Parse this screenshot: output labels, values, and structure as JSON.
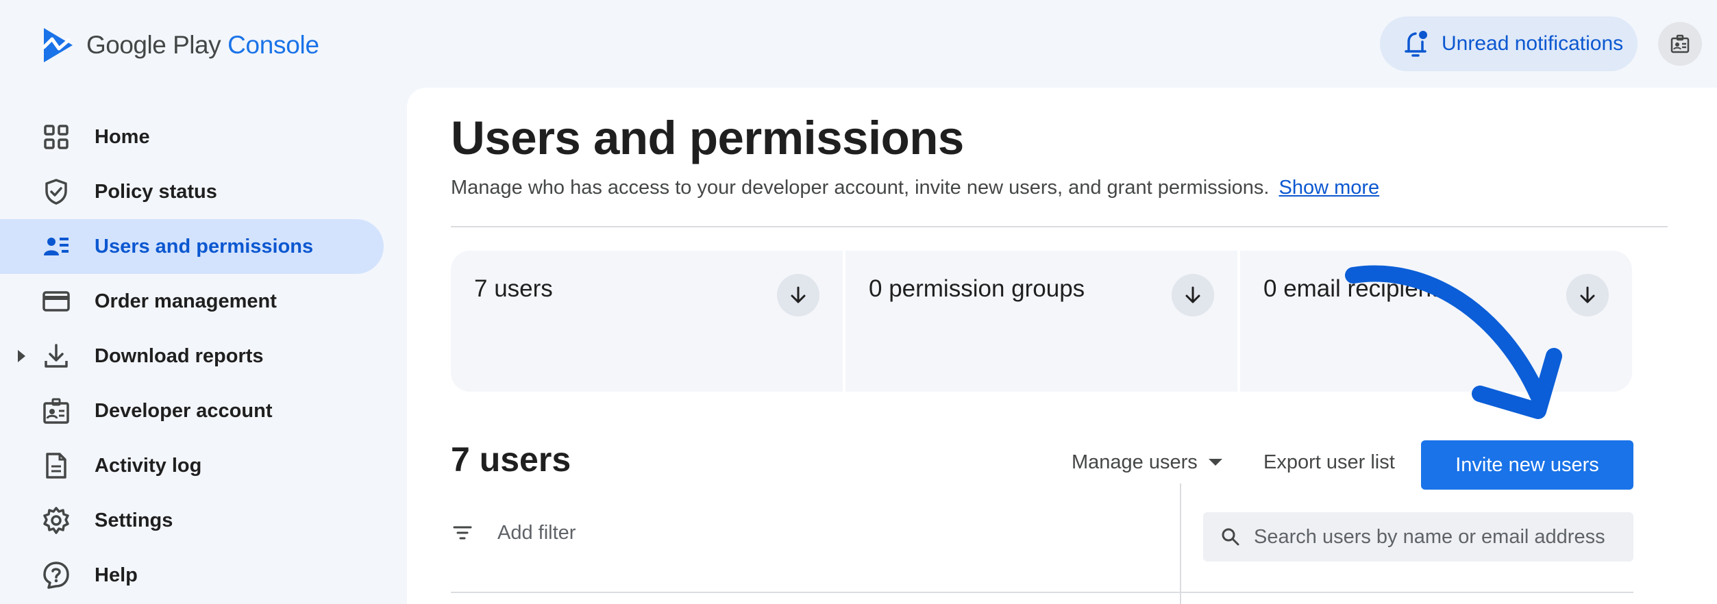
{
  "header": {
    "brand_name": "Google Play",
    "brand_console": "Console",
    "notifications_label": "Unread notifications"
  },
  "sidebar": {
    "items": [
      {
        "label": "Home",
        "icon": "grid-icon"
      },
      {
        "label": "Policy status",
        "icon": "shield-check-icon"
      },
      {
        "label": "Users and permissions",
        "icon": "users-list-icon",
        "active": true
      },
      {
        "label": "Order management",
        "icon": "credit-card-icon"
      },
      {
        "label": "Download reports",
        "icon": "download-icon",
        "expandable": true
      },
      {
        "label": "Developer account",
        "icon": "id-badge-icon"
      },
      {
        "label": "Activity log",
        "icon": "document-icon"
      },
      {
        "label": "Settings",
        "icon": "gear-icon"
      },
      {
        "label": "Help",
        "icon": "help-icon"
      }
    ]
  },
  "main": {
    "title": "Users and permissions",
    "description": "Manage who has access to your developer account, invite new users, and grant permissions.",
    "show_more": "Show more",
    "summary": [
      {
        "label": "7 users"
      },
      {
        "label": "0 permission groups"
      },
      {
        "label": "0 email recipients"
      }
    ],
    "section_title": "7 users",
    "manage_users": "Manage users",
    "export_list": "Export user list",
    "invite_button": "Invite new users",
    "add_filter": "Add filter",
    "search_placeholder": "Search users by name or email address"
  },
  "colors": {
    "accent": "#1a73e8",
    "active_nav_bg": "#d3e3fd",
    "annotation_arrow": "#0b5ed7"
  }
}
